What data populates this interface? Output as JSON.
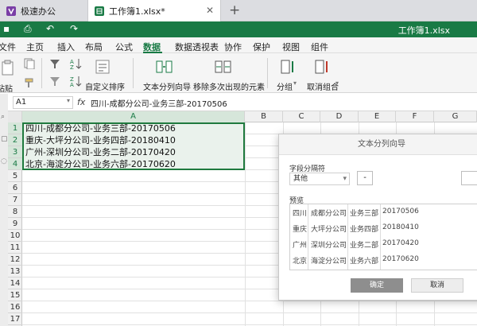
{
  "tabs": [
    {
      "label": "极速办公",
      "closable": false
    },
    {
      "label": "工作簿1.xlsx*",
      "closable": true
    }
  ],
  "window": {
    "title": "工作簿1.xlsx"
  },
  "menu": {
    "items": [
      "文件",
      "主页",
      "插入",
      "布局",
      "公式",
      "数据",
      "数据透视表",
      "协作",
      "保护",
      "视图",
      "组件"
    ],
    "active": "数据"
  },
  "ribbon": {
    "paste": "粘贴",
    "custom_sort": "自定义排序",
    "text_to_columns": "文本分列向导",
    "remove_duplicates": "移除多次出现的元素",
    "group": "分组",
    "ungroup": "取消组合"
  },
  "formula_bar": {
    "cell_ref": "A1",
    "fx": "fx",
    "content": "四川-成都分公司-业务三部-20170506"
  },
  "sheet": {
    "columns": [
      "A",
      "B",
      "C",
      "D",
      "E",
      "F",
      "G"
    ],
    "rows": [
      "1",
      "2",
      "3",
      "4",
      "5",
      "6",
      "7",
      "8",
      "9",
      "10",
      "11",
      "12",
      "13",
      "14",
      "15",
      "16",
      "17"
    ],
    "cells": [
      "四川-成都分公司-业务三部-20170506",
      "重庆-大坪分公司-业务四部-20180410",
      "广州-深圳分公司-业务二部-20170420",
      "北京-海淀分公司-业务六部-20170620"
    ]
  },
  "dialog": {
    "title": "文本分列向导",
    "separator_label": "字段分隔符",
    "separator_option": "其他",
    "separator_value": "-",
    "preview_label": "预览",
    "preview_rows": [
      [
        "四川",
        "成都分公司",
        "业务三部",
        "20170506"
      ],
      [
        "重庆",
        "大坪分公司",
        "业务四部",
        "20180410"
      ],
      [
        "广州",
        "深圳分公司",
        "业务二部",
        "20170420"
      ],
      [
        "北京",
        "海淀分公司",
        "业务六部",
        "20170620"
      ]
    ],
    "ok": "确定",
    "cancel": "取消"
  },
  "colors": {
    "accent": "#197a45",
    "selection_fill": "#eaf2ec",
    "selection_border": "#1f7a3e"
  }
}
